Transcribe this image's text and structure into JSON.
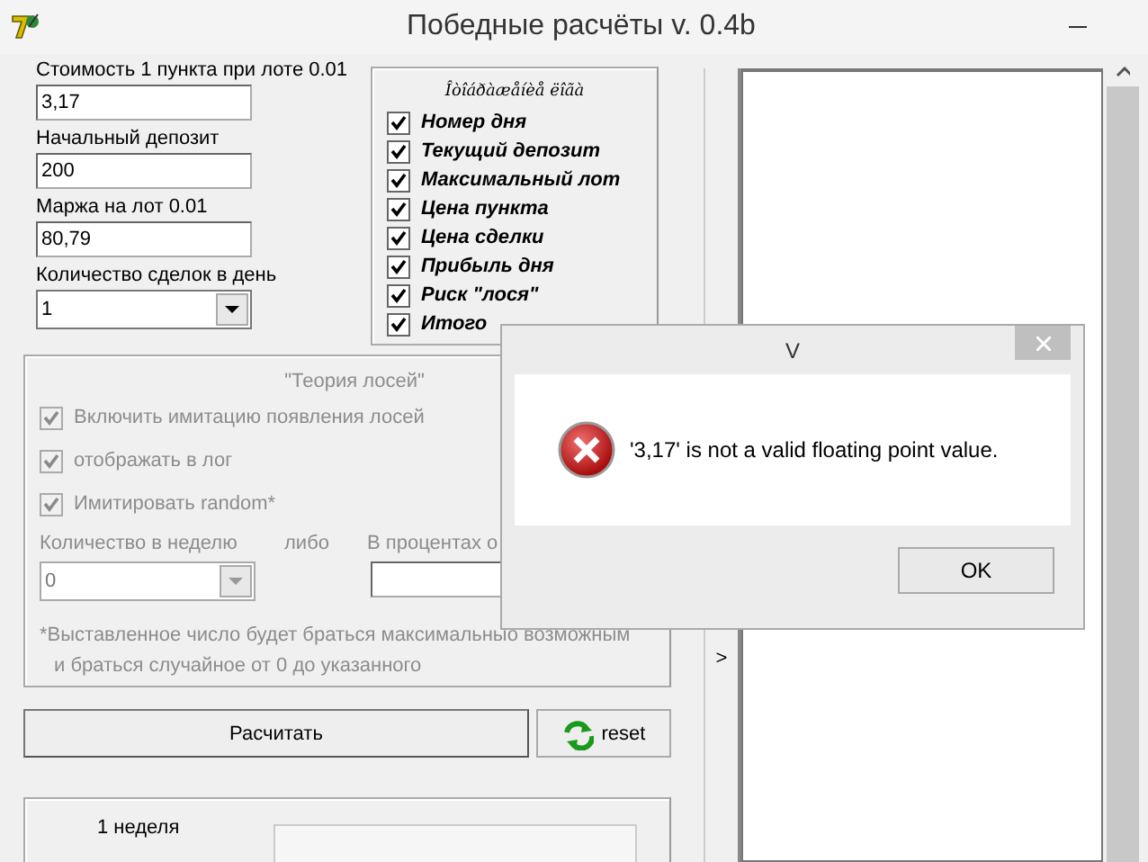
{
  "window": {
    "title": "Победные расчёты v. 0.4b"
  },
  "fields": [
    {
      "label": "Стоимость 1 пункта при лоте 0.01",
      "value": "3,17",
      "kind": "text"
    },
    {
      "label": "Начальный депозит",
      "value": "200",
      "kind": "text"
    },
    {
      "label": "Маржа на лот 0.01",
      "value": "80,79",
      "kind": "text"
    },
    {
      "label": "Количество сделок в день",
      "value": "1",
      "kind": "combo"
    }
  ],
  "display_group": {
    "title": "Îòîáðàæåíèå ëîãà",
    "items": [
      {
        "label": "Номер дня",
        "checked": true
      },
      {
        "label": "Текущий депозит",
        "checked": true
      },
      {
        "label": "Максимальный лот",
        "checked": true
      },
      {
        "label": "Цена пункта",
        "checked": true
      },
      {
        "label": "Цена сделки",
        "checked": true
      },
      {
        "label": "Прибыль дня",
        "checked": true
      },
      {
        "label": "Риск \"лося\"",
        "checked": true
      },
      {
        "label": "Итого",
        "checked": true
      }
    ]
  },
  "moose_group": {
    "title": "\"Теория лосей\"",
    "disabled": true,
    "options": [
      {
        "label": "Включить имитацию появления лосей",
        "checked": true
      },
      {
        "label": "отображать в лог",
        "checked": true
      },
      {
        "label": "Имитировать random*",
        "checked": true
      }
    ],
    "weekly": {
      "label": "Количество в неделю",
      "value": "0"
    },
    "or_label": "либо",
    "percent": {
      "label": "В процентах о"
    },
    "note": [
      "*Выставленное число будет браться максимальныо возможным",
      "и браться случайное от 0 до указанного"
    ]
  },
  "buttons": [
    {
      "label": "Расчитать",
      "kind": "calc"
    },
    {
      "label": "reset",
      "kind": "reset"
    }
  ],
  "results": {
    "week_label": "1 неделя"
  },
  "splitter": {
    "arrow": ">"
  },
  "dialog": {
    "title": "V",
    "message": "'3,17' is not a valid floating point value.",
    "button": "OK"
  }
}
